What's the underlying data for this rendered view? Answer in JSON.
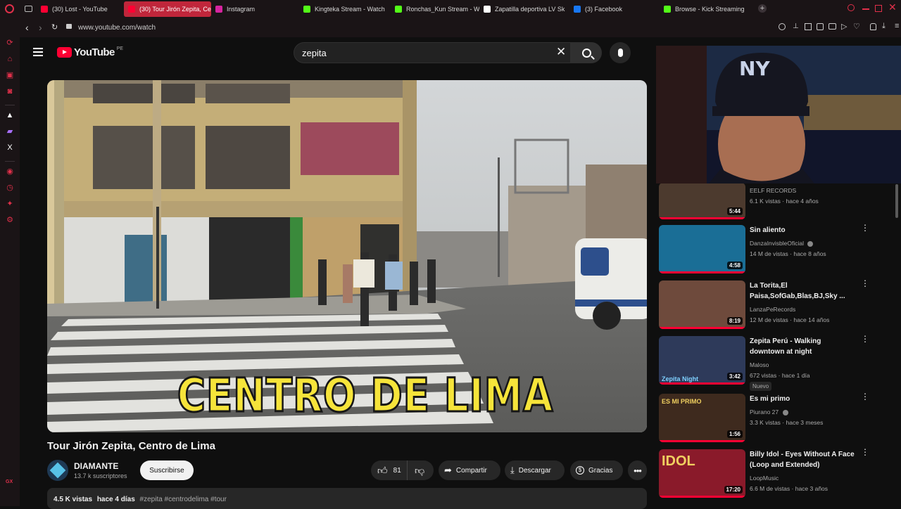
{
  "browser": {
    "tabs": [
      {
        "label": "(30) Lost - YouTube",
        "icon": "youtube-icon",
        "color": "#ff0033"
      },
      {
        "label": "(30) Tour Jirón Zepita, Ce",
        "icon": "youtube-icon",
        "color": "#ff0033",
        "active": true
      },
      {
        "label": "Instagram",
        "icon": "instagram-icon",
        "color": "#d6249f"
      },
      {
        "label": "Kingteka Stream - Watch",
        "icon": "kick-icon",
        "color": "#53fc18"
      },
      {
        "label": "Ronchas_Kun Stream - W",
        "icon": "kick-icon",
        "color": "#53fc18"
      },
      {
        "label": "Zapatilla deportiva LV Sk",
        "icon": "lv-icon",
        "color": "#ffffff"
      },
      {
        "label": "(3) Facebook",
        "icon": "facebook-icon",
        "color": "#1877f2"
      },
      {
        "label": "Browse - Kick Streaming",
        "icon": "kick-icon",
        "color": "#53fc18"
      }
    ],
    "url": "www.youtube.com/watch",
    "gx_label": "GX"
  },
  "header": {
    "logo_text": "YouTube",
    "region": "PE",
    "search_value": "zepita"
  },
  "video": {
    "overlay_text": "CENTRO DE LIMA",
    "title": "Tour Jirón Zepita, Centro de Lima",
    "channel": "DIAMANTE",
    "subscribers": "13.7 k suscriptores",
    "subscribe_label": "Suscribirse",
    "likes": "81",
    "share_label": "Compartir",
    "download_label": "Descargar",
    "thanks_label": "Gracias",
    "views": "4.5 K vistas",
    "age": "hace 4 días",
    "hashtags": "#zepita #centrodelima #tour"
  },
  "recommendations": [
    {
      "title": "",
      "channel": "EELF RECORDS",
      "meta": "6.1 K vistas · hace 4 años",
      "duration": "5:44",
      "verified": false
    },
    {
      "title": "Sin aliento",
      "channel": "DanzaInvisbleOficial",
      "meta": "14 M de vistas · hace 8 años",
      "duration": "4:58",
      "verified": true
    },
    {
      "title": "La Torita,El Paisa,SofGab,Blas,BJ,Sky ...",
      "channel": "LanzaPeRecords",
      "meta": "12 M de vistas · hace 14 años",
      "duration": "8:19",
      "verified": false
    },
    {
      "title": "Zepita Perú - Walking downtown at night",
      "channel": "Maloso",
      "meta": "672 vistas · hace 1 día",
      "duration": "3:42",
      "badge": "Nuevo",
      "thumb_text": "Zepita Night",
      "verified": false
    },
    {
      "title": "Es mi primo",
      "channel": "Piurano 27",
      "meta": "3.3 K vistas · hace 3 meses",
      "duration": "1:56",
      "thumb_text": "ES MI PRIMO",
      "verified": true
    },
    {
      "title": "Billy Idol - Eyes Without A Face (Loop and Extended)",
      "channel": "LoopMusic",
      "meta": "6.6 M de vistas · hace 3 años",
      "duration": "17:20",
      "thumb_text": "IDOL",
      "verified": false
    }
  ],
  "colors": {
    "accent": "#ff0033",
    "browser_accent": "#c0263b",
    "overlay_yellow": "#f6e43a"
  }
}
